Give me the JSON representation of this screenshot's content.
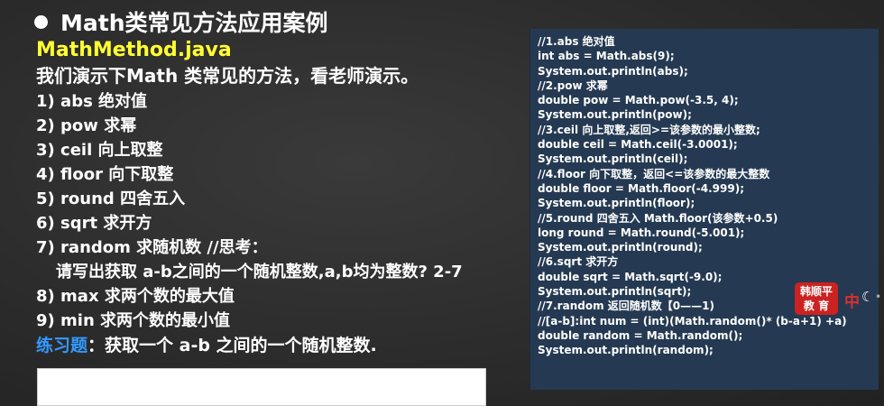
{
  "slide": {
    "title": "Math类常见方法应用案例",
    "filename": "MathMethod.java",
    "intro": "我们演示下Math 类常见的方法，看老师演示。",
    "items": [
      {
        "num": "1)",
        "text": "abs 绝对值"
      },
      {
        "num": "2)",
        "text": "pow 求幂"
      },
      {
        "num": "3)",
        "text": "ceil 向上取整"
      },
      {
        "num": "4)",
        "text": "floor 向下取整"
      },
      {
        "num": "5)",
        "text": "round 四舍五入"
      },
      {
        "num": "6)",
        "text": "sqrt 求开方"
      },
      {
        "num": "7)",
        "text": "random 求随机数 //思考："
      }
    ],
    "sub_item": "请写出获取 a-b之间的一个随机整数,a,b均为整数? 2-7",
    "items2": [
      {
        "num": "8)",
        "text": "max 求两个数的最大值"
      },
      {
        "num": "9)",
        "text": "min 求两个数的最小值"
      }
    ],
    "exercise_label": "练习题",
    "exercise_text": "：获取一个 a-b 之间的一个随机整数."
  },
  "code": [
    "//1.abs 绝对值",
    "int abs = Math.abs(9);",
    "System.out.println(abs);",
    "//2.pow 求幂",
    "double pow = Math.pow(-3.5, 4);",
    "System.out.println(pow);",
    "//3.ceil 向上取整,返回>=该参数的最小整数;",
    "double ceil = Math.ceil(-3.0001);",
    "System.out.println(ceil);",
    "//4.floor 向下取整，返回<=该参数的最大整数",
    "double floor = Math.floor(-4.999);",
    "System.out.println(floor);",
    "//5.round 四舍五入  Math.floor(该参数+0.5)",
    "long round = Math.round(-5.001);",
    "System.out.println(round);",
    "//6.sqrt 求开方",
    "double sqrt = Math.sqrt(-9.0);",
    "System.out.println(sqrt);",
    "//7.random 返回随机数【0——1)",
    "//[a-b]:int num = (int)(Math.random()*  (b-a+1)  +a)",
    "double random = Math.random();",
    "System.out.println(random);"
  ],
  "badge": {
    "line1": "韩顺平",
    "line2": "教 育"
  },
  "toolbar": {
    "zh": "中"
  }
}
